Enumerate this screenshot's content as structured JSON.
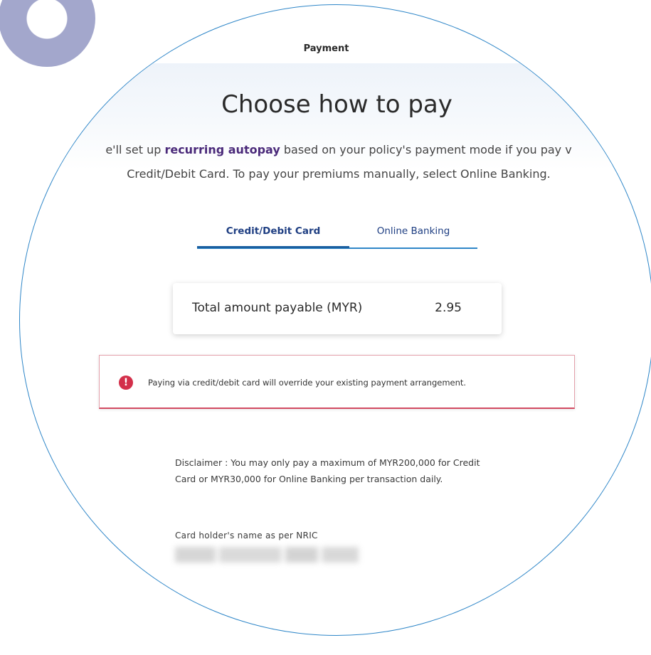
{
  "header": {
    "title": "Payment"
  },
  "main": {
    "heading": "Choose how to pay",
    "intro": {
      "line1_prefix": "e'll set up ",
      "line1_highlight": "recurring autopay",
      "line1_suffix": " based on your policy's payment mode if you pay v",
      "line2": "Credit/Debit Card. To pay your premiums manually, select Online Banking."
    },
    "tabs": [
      {
        "label": "Credit/Debit Card",
        "active": true
      },
      {
        "label": "Online Banking",
        "active": false
      }
    ],
    "amount": {
      "label": "Total amount payable (MYR)",
      "value": "2.95"
    },
    "alert": {
      "icon": "exclamation-icon",
      "text": "Paying via credit/debit card will override your existing payment arrangement."
    },
    "disclaimer": "Disclaimer : You may only pay a maximum of MYR200,000 for Credit Card or MYR30,000 for Online Banking per transaction daily.",
    "card_holder": {
      "label": "Card holder's name as per NRIC"
    }
  },
  "colors": {
    "accent_blue": "#2e86c8",
    "tab_text": "#1e3e82",
    "highlight_purple": "#4a2a7a",
    "alert_red": "#d32f4a",
    "decor_lavender": "#a3a7cc"
  }
}
